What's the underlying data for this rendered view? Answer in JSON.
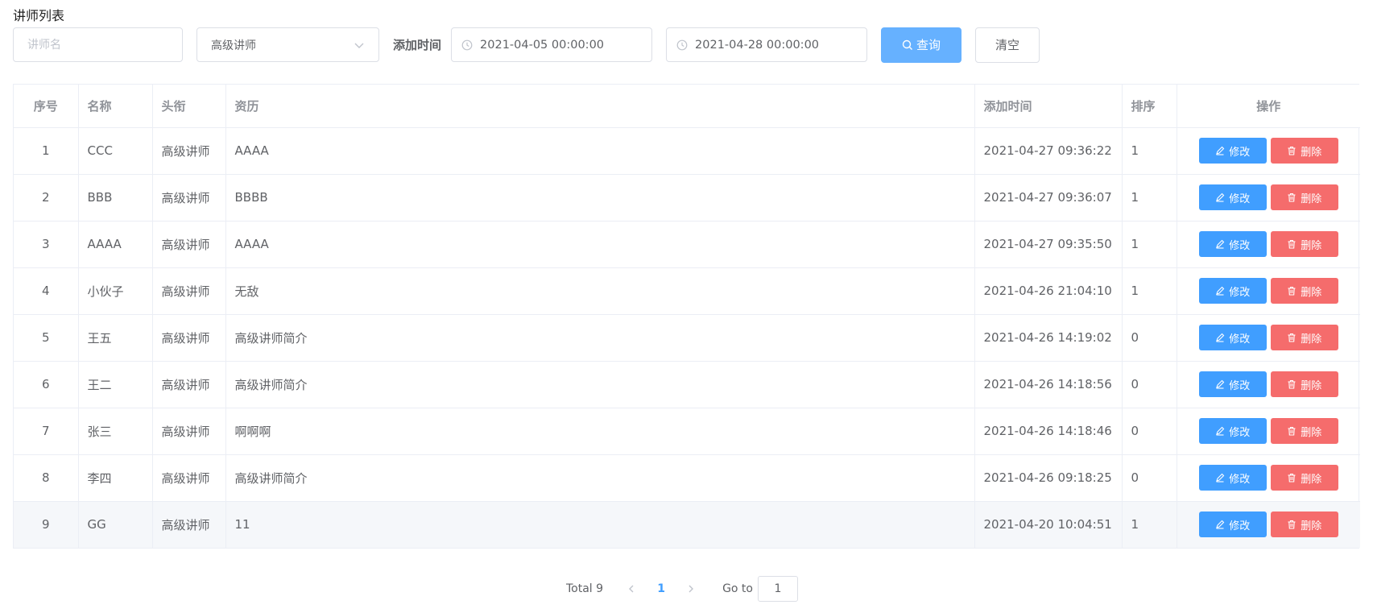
{
  "page": {
    "title": "讲师列表"
  },
  "filters": {
    "name_placeholder": "讲师名",
    "name_value": "",
    "level_selected": "高级讲师",
    "time_label": "添加时间",
    "date_start": "2021-04-05 00:00:00",
    "date_end": "2021-04-28 00:00:00",
    "query_label": "查询",
    "clear_label": "清空"
  },
  "table": {
    "columns": [
      "序号",
      "名称",
      "头衔",
      "资历",
      "添加时间",
      "排序",
      "操作"
    ],
    "edit_label": "修改",
    "delete_label": "删除",
    "rows": [
      {
        "index": "1",
        "name": "CCC",
        "level": "高级讲师",
        "intro": "AAAA",
        "time": "2021-04-27 09:36:22",
        "sort": "1"
      },
      {
        "index": "2",
        "name": "BBB",
        "level": "高级讲师",
        "intro": "BBBB",
        "time": "2021-04-27 09:36:07",
        "sort": "1"
      },
      {
        "index": "3",
        "name": "AAAA",
        "level": "高级讲师",
        "intro": "AAAA",
        "time": "2021-04-27 09:35:50",
        "sort": "1"
      },
      {
        "index": "4",
        "name": "小伙子",
        "level": "高级讲师",
        "intro": "无敌",
        "time": "2021-04-26 21:04:10",
        "sort": "1"
      },
      {
        "index": "5",
        "name": "王五",
        "level": "高级讲师",
        "intro": "高级讲师简介",
        "time": "2021-04-26 14:19:02",
        "sort": "0"
      },
      {
        "index": "6",
        "name": "王二",
        "level": "高级讲师",
        "intro": "高级讲师简介",
        "time": "2021-04-26 14:18:56",
        "sort": "0"
      },
      {
        "index": "7",
        "name": "张三",
        "level": "高级讲师",
        "intro": "啊啊啊",
        "time": "2021-04-26 14:18:46",
        "sort": "0"
      },
      {
        "index": "8",
        "name": "李四",
        "level": "高级讲师",
        "intro": "高级讲师简介",
        "time": "2021-04-26 09:18:25",
        "sort": "0"
      },
      {
        "index": "9",
        "name": "GG",
        "level": "高级讲师",
        "intro": "11",
        "time": "2021-04-20 10:04:51",
        "sort": "1"
      }
    ]
  },
  "pagination": {
    "total": "Total 9",
    "current_page": "1",
    "goto_label": "Go to",
    "goto_value": "1"
  },
  "colors": {
    "primary": "#409eff",
    "primary_light": "#66b1ff",
    "danger": "#f56c6c",
    "hover_row": "#f5f7fa"
  },
  "icons": [
    "chevron-down-icon",
    "clock-icon",
    "search-icon",
    "edit-icon",
    "trash-icon",
    "chevron-left-icon",
    "chevron-right-icon"
  ]
}
